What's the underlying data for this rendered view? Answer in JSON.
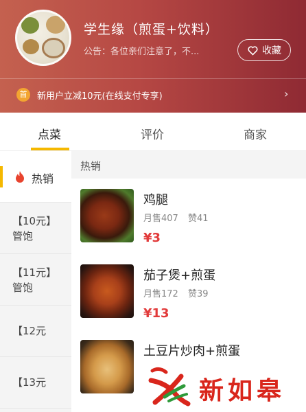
{
  "shop": {
    "title": "学生缘（煎蛋+饮料）",
    "notice": "公告：各位亲们注意了，不...",
    "favorite_label": "收藏"
  },
  "promo": {
    "badge": "首",
    "text": "新用户立减10元(在线支付专享)",
    "arrow": "›"
  },
  "tabs": [
    {
      "label": "点菜",
      "active": true
    },
    {
      "label": "评价",
      "active": false
    },
    {
      "label": "商家",
      "active": false
    }
  ],
  "sidebar": {
    "items": [
      {
        "label": "热销",
        "active": true
      },
      {
        "label": "【10元】管饱"
      },
      {
        "label": "【11元】管饱"
      },
      {
        "label": "【12元"
      },
      {
        "label": "【13元"
      }
    ]
  },
  "menu": {
    "section_title": "热销",
    "items": [
      {
        "name": "鸡腿",
        "monthly_sales": "月售407",
        "likes": "赞41",
        "price": "¥3"
      },
      {
        "name": "茄子煲+煎蛋",
        "monthly_sales": "月售172",
        "likes": "赞39",
        "price": "¥13"
      },
      {
        "name": "土豆片炒肉+煎蛋"
      }
    ]
  },
  "watermark": {
    "text": "新如皋"
  },
  "colors": {
    "header_start": "#c4614f",
    "header_end": "#8f2a33",
    "accent_yellow": "#f5b800",
    "price_red": "#e23b3b",
    "promo_badge": "#f3a531"
  }
}
